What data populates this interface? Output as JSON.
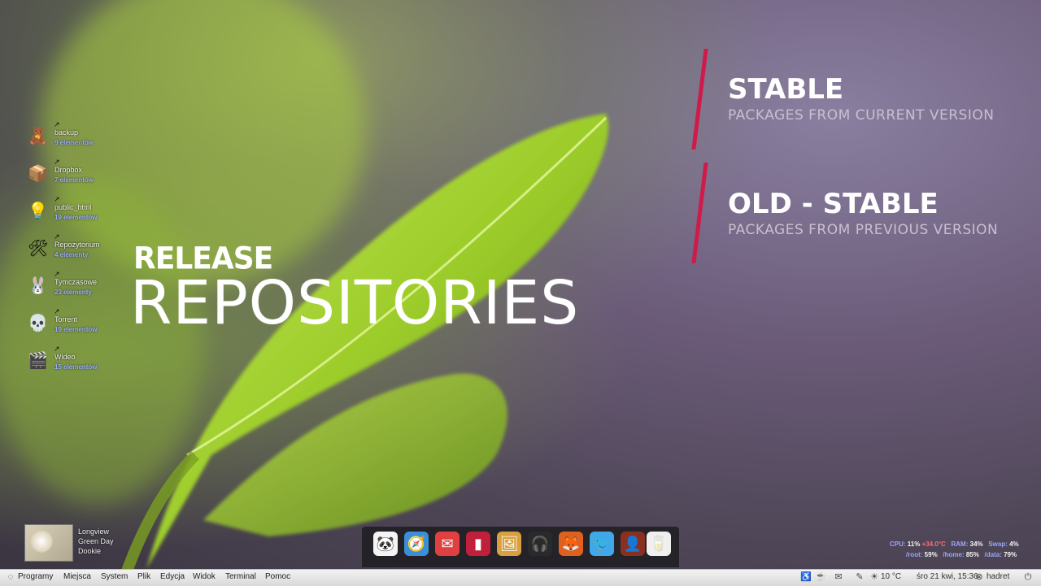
{
  "slide": {
    "release_label": "RELEASE",
    "repos_label": "REPOSITORIES",
    "items": [
      {
        "title": "STABLE",
        "subtitle": "PACKAGES FROM CURRENT VERSION"
      },
      {
        "title": "OLD - STABLE",
        "subtitle": "PACKAGES FROM PREVIOUS VERSION"
      }
    ],
    "accent_color": "#d01a4a"
  },
  "desktop": {
    "icons": [
      {
        "name": "backup",
        "count": "9 elementów",
        "icon": "teddy-bear-icon",
        "glyph": "🧸"
      },
      {
        "name": "Dropbox",
        "count": "7 elementów",
        "icon": "dropbox-icon",
        "glyph": "📦"
      },
      {
        "name": "public_html",
        "count": "19 elementów",
        "icon": "lightbulb-icon",
        "glyph": "💡"
      },
      {
        "name": "Repozytorium",
        "count": "4 elementy",
        "icon": "tools-icon",
        "glyph": "🛠"
      },
      {
        "name": "Tymczasowe",
        "count": "23 elementy",
        "icon": "bunny-icon",
        "glyph": "🐰"
      },
      {
        "name": "Torrent",
        "count": "19 elementów",
        "icon": "skull-icon",
        "glyph": "💀"
      },
      {
        "name": "Wideo",
        "count": "15 elementów",
        "icon": "clapperboard-icon",
        "glyph": "🎬"
      }
    ]
  },
  "music_widget": {
    "track": "Longview",
    "artist": "Green Day",
    "album": "Dookie"
  },
  "dock": {
    "apps": [
      {
        "icon": "panda-icon",
        "glyph": "🐼",
        "color": "#f4f4f4"
      },
      {
        "icon": "compass-icon",
        "glyph": "🧭",
        "color": "#3a8fd8"
      },
      {
        "icon": "gmail-icon",
        "glyph": "✉",
        "color": "#e04040"
      },
      {
        "icon": "terminal-icon",
        "glyph": "▮",
        "color": "#c0203a"
      },
      {
        "icon": "image-viewer-icon",
        "glyph": "🖼",
        "color": "#d8a040"
      },
      {
        "icon": "headphones-icon",
        "glyph": "🎧",
        "color": "#2a2a2a"
      },
      {
        "icon": "firefox-icon",
        "glyph": "🦊",
        "color": "#e06020"
      },
      {
        "icon": "twitter-icon",
        "glyph": "🐦",
        "color": "#40a8e8"
      },
      {
        "icon": "avatar-icon",
        "glyph": "👤",
        "color": "#8a3020"
      },
      {
        "icon": "milk-carton-icon",
        "glyph": "🥛",
        "color": "#f0f0f0"
      }
    ]
  },
  "system_monitor": {
    "cpu_label": "CPU:",
    "cpu_value": "11%",
    "cpu_temp": "+34.0°C",
    "ram_label": "RAM:",
    "ram_value": "34%",
    "swap_label": "Swap:",
    "swap_value": "4%",
    "root_label": "/root:",
    "root_value": "59%",
    "home_label": "/home:",
    "home_value": "85%",
    "data_label": "/data:",
    "data_value": "79%"
  },
  "taskbar": {
    "menu": [
      "Programy",
      "Miejsca",
      "System",
      "Plik",
      "Edycja",
      "Widok",
      "Terminal",
      "Pomoc"
    ],
    "weather": "10 °C",
    "datetime": "śro 21 kwi, 15:36",
    "user": "hadret"
  }
}
